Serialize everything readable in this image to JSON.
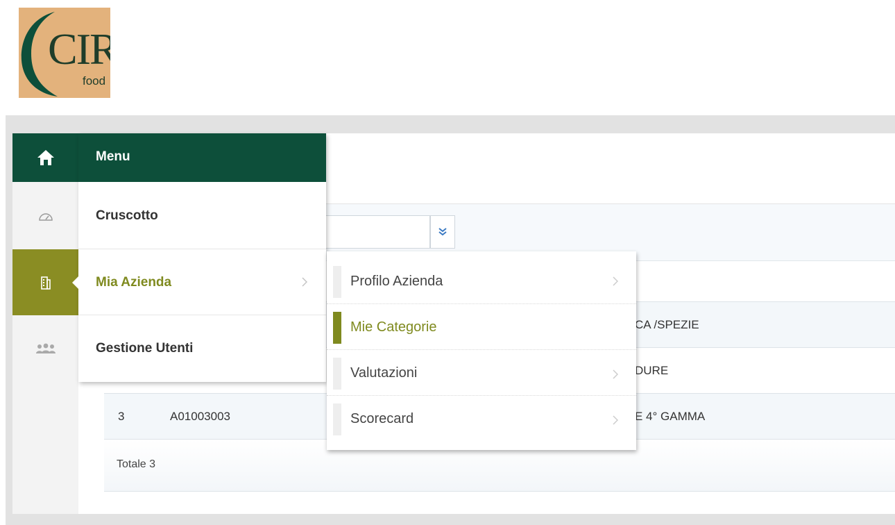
{
  "logo": {
    "brand": "CIR",
    "sub": "food"
  },
  "menu": {
    "header_label": "Menu",
    "items": [
      {
        "label": "Cruscotto"
      },
      {
        "label": "Mia Azienda"
      },
      {
        "label": "Gestione Utenti"
      }
    ]
  },
  "submenu": {
    "items": [
      {
        "label": "Profilo Azienda"
      },
      {
        "label": "Mie Categorie"
      },
      {
        "label": "Valutazioni"
      },
      {
        "label": "Scorecard"
      }
    ]
  },
  "table": {
    "rows": [
      {
        "desc_fragment": "CA /SPEZIE"
      },
      {
        "desc_fragment": "DURE"
      },
      {
        "num": "3",
        "code": "A01003003",
        "desc_fragment": "E 4° GAMMA"
      }
    ],
    "total_label": "Totale 3"
  },
  "colors": {
    "primary": "#0d4f3a",
    "accent": "#8a8d23",
    "accent_text": "#7f8a1f",
    "logo_bg": "#e3b27c"
  },
  "icons": {
    "home": "home-icon",
    "dashboard": "speedometer-icon",
    "company": "building-icon",
    "users": "users-group-icon",
    "dropdown": "double-chevron-down-icon",
    "chevron": "chevron-right-icon"
  }
}
